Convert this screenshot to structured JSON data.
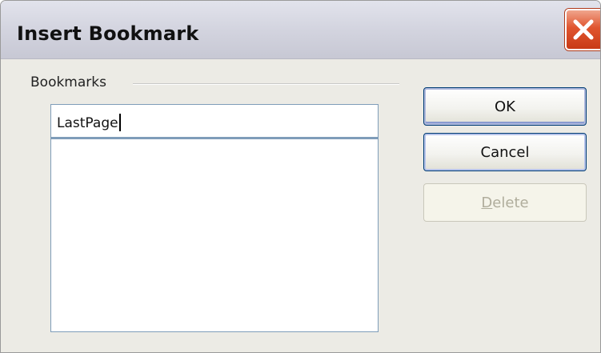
{
  "dialog": {
    "title": "Insert Bookmark"
  },
  "bookmarks_group": {
    "label": "Bookmarks",
    "input_value": "LastPage",
    "list_items": []
  },
  "buttons": {
    "ok_label": "OK",
    "cancel_label": "Cancel",
    "delete_mnemonic": "D",
    "delete_rest": "elete"
  },
  "colors": {
    "title_bar": "#d3d4df",
    "close_button": "#e0552f",
    "dialog_body": "#ecebe5",
    "button_border": "#003c74",
    "input_border": "#7f9db9"
  },
  "icons": {
    "close": "close-x-icon"
  }
}
